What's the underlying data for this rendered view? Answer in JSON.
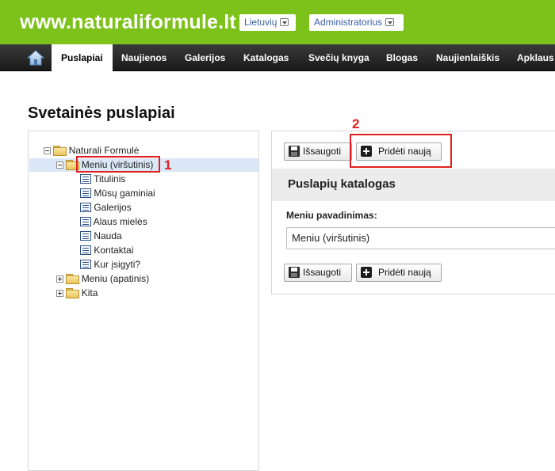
{
  "header": {
    "site_title": "www.naturaliformule.lt",
    "language_label": "Lietuvių",
    "user_label": "Administratorius",
    "brand_color": "#7cc21b"
  },
  "nav": {
    "home_icon": "home-icon",
    "items": [
      {
        "label": "Puslapiai",
        "active": true
      },
      {
        "label": "Naujienos"
      },
      {
        "label": "Galerijos"
      },
      {
        "label": "Katalogas"
      },
      {
        "label": "Svečių knyga"
      },
      {
        "label": "Blogas"
      },
      {
        "label": "Naujienlaiškis"
      },
      {
        "label": "Apklaus"
      }
    ]
  },
  "page": {
    "heading": "Svetainės puslapiai"
  },
  "tree": {
    "root": "Naturali Formulė",
    "menu_top": "Meniu (viršutinis)",
    "pages": [
      "Titulinis",
      "Mūsų gaminiai",
      "Galerijos",
      "Alaus mielės",
      "Nauda",
      "Kontaktai",
      "Kur įsigyti?"
    ],
    "menu_bottom": "Meniu (apatinis)",
    "other": "Kita"
  },
  "annotations": {
    "marker_1": "1",
    "marker_2": "2",
    "color": "#e02020"
  },
  "form": {
    "save_label": "Išsaugoti",
    "add_label": "Pridėti naują",
    "section_title": "Puslapių katalogas",
    "menu_name_label": "Meniu pavadinimas:",
    "menu_name_value": "Meniu (viršutinis)"
  }
}
